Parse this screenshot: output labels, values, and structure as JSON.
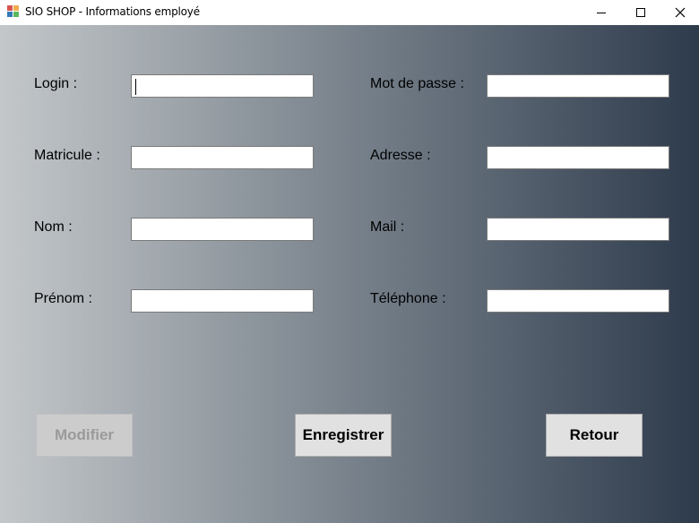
{
  "window": {
    "title": "SIO SHOP - Informations employé",
    "minimize_icon": "minimize-icon",
    "maximize_icon": "maximize-icon",
    "close_icon": "close-icon"
  },
  "form": {
    "left": [
      {
        "label": "Login :",
        "value": ""
      },
      {
        "label": "Matricule :",
        "value": ""
      },
      {
        "label": "Nom :",
        "value": ""
      },
      {
        "label": "Prénom :",
        "value": ""
      }
    ],
    "right": [
      {
        "label": "Mot de passe :",
        "value": ""
      },
      {
        "label": "Adresse :",
        "value": ""
      },
      {
        "label": "Mail :",
        "value": ""
      },
      {
        "label": "Téléphone :",
        "value": ""
      }
    ]
  },
  "buttons": {
    "modifier": "Modifier",
    "enregistrer": "Enregistrer",
    "retour": "Retour"
  },
  "colors": {
    "gradient_start": "#c3c7ca",
    "gradient_end": "#2e3b4c"
  }
}
